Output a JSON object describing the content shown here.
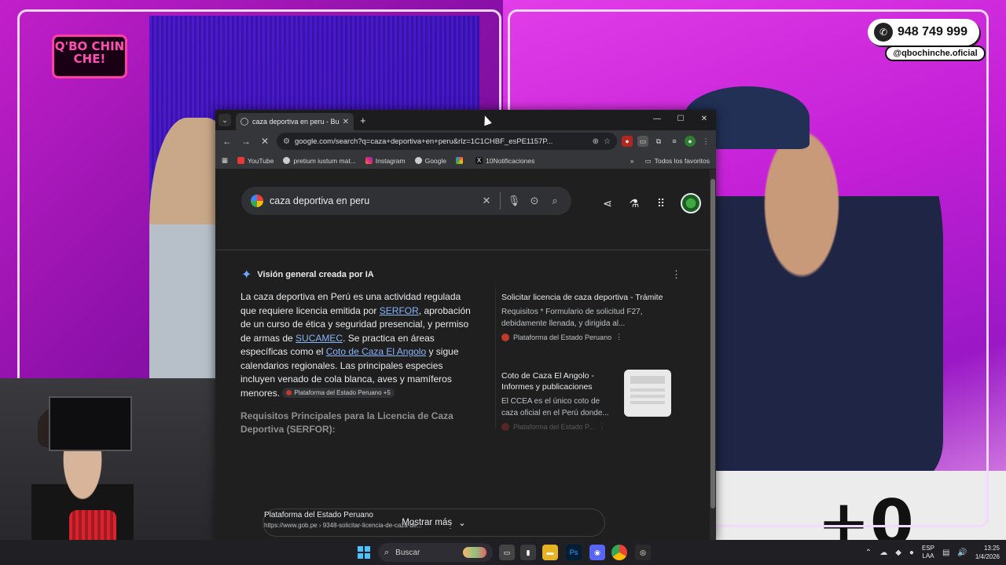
{
  "stream": {
    "logo_text": "Q'BO CHIN CHE!",
    "phone": "948 749 999",
    "handle": "@qbochinche.oficial",
    "big_digits": "+0"
  },
  "browser": {
    "tab_title": "caza deportiva en peru - Buscar",
    "url": "google.com/search?q=caza+deportiva+en+peru&rlz=1C1CHBF_esPE1157P...",
    "bookmarks": [
      "YouTube",
      "pretium iustum mat...",
      "Instagram",
      "Google",
      "",
      "10Notificaciones"
    ],
    "all_favorites": "Todos los favoritos"
  },
  "google": {
    "query": "caza deportiva en peru",
    "ai_heading": "Visión general creada por IA",
    "ai_p1": "La caza deportiva en Perú es una actividad regulada que requiere licencia emitida por ",
    "ai_link1": "SERFOR",
    "ai_p2": ", aprobación de un curso de ética y seguridad presencial, y permiso de armas de ",
    "ai_link2": "SUCAMEC",
    "ai_p3": ". Se practica en áreas específicas como el ",
    "ai_link3": "Coto de Caza El Angolo",
    "ai_p4": " y sigue calendarios regionales. Las principales especies incluyen venado de cola blanca, aves y mamíferos menores.",
    "ai_chip": "Plataforma del Estado Peruano +5",
    "ai_subheading": "Requisitos Principales para la Licencia de Caza Deportiva (SERFOR):",
    "card1": {
      "title": "Solicitar licencia de caza deportiva - Trámite",
      "desc": "Requisitos * Formulario de solicitud F27, debidamente llenada, y dirigida al...",
      "source": "Plataforma del Estado Peruano"
    },
    "card2": {
      "title": "Coto de Caza El Angolo - Informes y publicaciones",
      "desc": "El CCEA es el único coto de caza oficial en el Perú donde...",
      "source": "Plataforma del Estado P..."
    },
    "show_more": "Mostrar más",
    "result": {
      "site": "Plataforma del Estado Peruano",
      "url": "https://www.gob.pe › 9348-solicitar-licencia-de-caza-de..."
    }
  },
  "taskbar": {
    "search": "Buscar",
    "lang_top": "ESP",
    "lang_bottom": "LAA",
    "time": "13:25",
    "date": "1/4/2026"
  }
}
